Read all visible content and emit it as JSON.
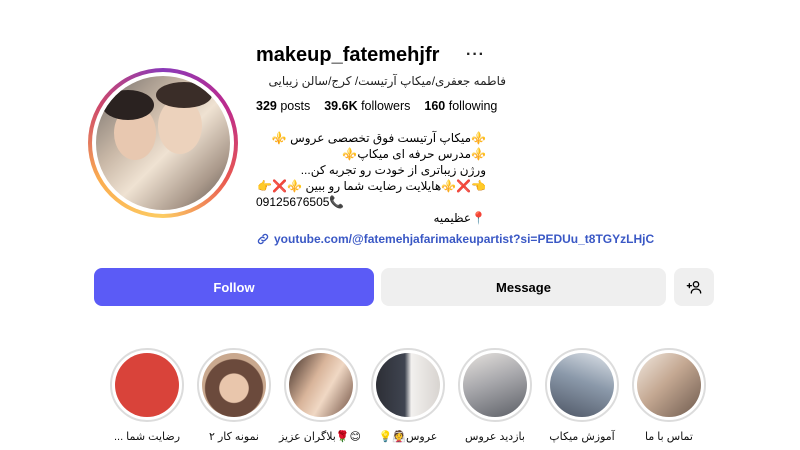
{
  "profile": {
    "username": "makeup_fatemehjfr",
    "more_icon": "···",
    "full_name": "فاطمه جعفری/میکاپ آرتیست/ کرج/سالن زیبایی"
  },
  "stats": {
    "posts": "329",
    "posts_label": "posts",
    "followers": "39.6K",
    "followers_label": "followers",
    "following": "160",
    "following_label": "following"
  },
  "bio": {
    "line1": "⚜️میکاپ آرتیست فوق تخصصی عروس ⚜️",
    "line2": "⚜️مدرس حرفه ای میکاپ⚜️",
    "line3": "ورژن زیباتری از خودت رو تجربه کن...",
    "line4": "👈❌⚜️هایلایت رضایت شما رو ببین ⚜️❌👉",
    "line5": "09125676505📞",
    "line6": "📍عظیمیه"
  },
  "link": {
    "text": "youtube.com/@fatemehjafarimakeupartist?si=PEDUu_t8TGYzLHjC"
  },
  "actions": {
    "follow": "Follow",
    "message": "Message",
    "add_user_icon": "+👤"
  },
  "highlights": [
    {
      "label": "رضایت شما ...",
      "color": "#d9433a"
    },
    {
      "label": "نمونه کار ۲",
      "color": "#b58e78"
    },
    {
      "label": "😊🌹بلاگران عزیز",
      "color": "#8e6a5a"
    },
    {
      "label": "عروس👰💡",
      "color": "#54606c"
    },
    {
      "label": "بازدید عروس",
      "color": "#9aa0a8"
    },
    {
      "label": "آموزش میکاپ",
      "color": "#7d8ea0"
    },
    {
      "label": "تماس با ما",
      "color": "#c8b4a4"
    }
  ]
}
